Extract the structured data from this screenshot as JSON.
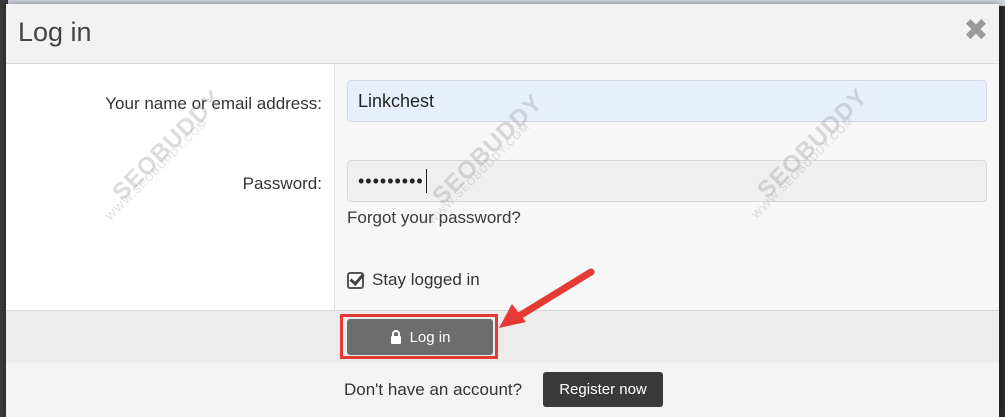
{
  "dialog": {
    "title": "Log in",
    "close_icon": "close-icon"
  },
  "form": {
    "username_label": "Your name or email address:",
    "username_value": "Linkchest",
    "password_label": "Password:",
    "password_value": "•••••••••",
    "forgot_label": "Forgot your password?",
    "remember_label": "Stay logged in",
    "remember_checked": true
  },
  "footer": {
    "login_label": "Log in",
    "login_icon": "lock-icon"
  },
  "register": {
    "prompt": "Don't have an account?",
    "button_label": "Register now"
  },
  "watermark": {
    "brand": "SEOBUDDY",
    "url": "WWW.SEOBUDDY.COM"
  },
  "colors": {
    "highlight": "#e53935",
    "login_button": "#6d6d6d",
    "register_button": "#3a3a3a",
    "autofill_bg": "#e8effc"
  }
}
